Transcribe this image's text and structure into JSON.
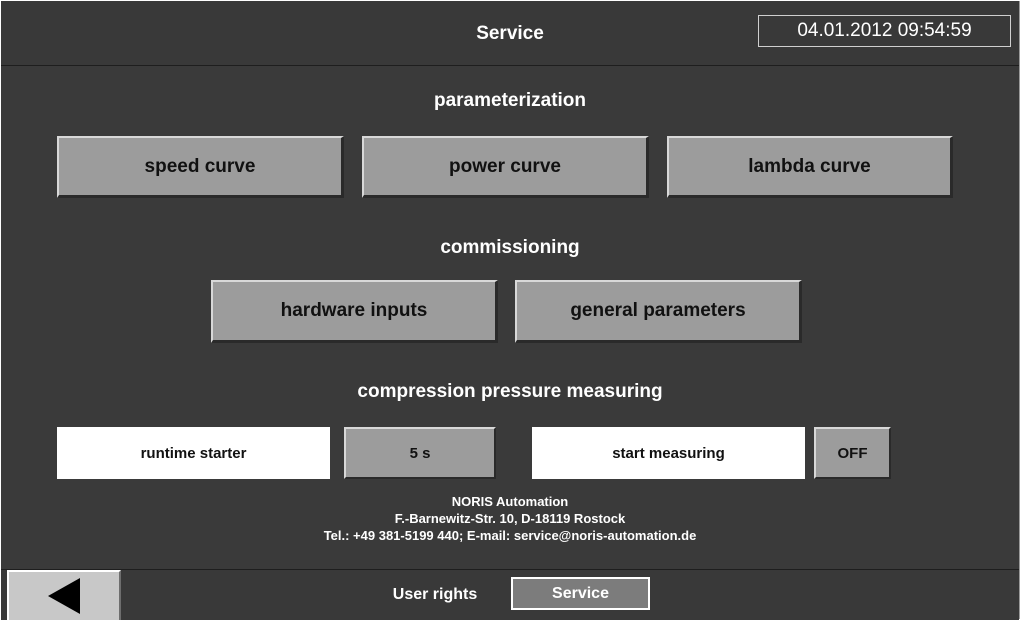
{
  "header": {
    "title": "Service",
    "datetime": "04.01.2012 09:54:59"
  },
  "parameterization": {
    "title": "parameterization",
    "buttons": [
      "speed curve",
      "power curve",
      "lambda curve"
    ]
  },
  "commissioning": {
    "title": "commissioning",
    "buttons": [
      "hardware inputs",
      "general parameters"
    ]
  },
  "compression": {
    "title": "compression pressure measuring",
    "runtime_label": "runtime starter",
    "runtime_value": "5 s",
    "start_label": "start measuring",
    "start_value": "OFF"
  },
  "company": {
    "name": "NORIS Automation",
    "address": "F.-Barnewitz-Str.  10, D-18119 Rostock",
    "contact": "Tel.: +49 381-5199 440; E-mail: service@noris-automation.de"
  },
  "footer": {
    "back_icon": "left-triangle-icon",
    "user_rights_label": "User rights",
    "user_rights_value": "Service"
  }
}
